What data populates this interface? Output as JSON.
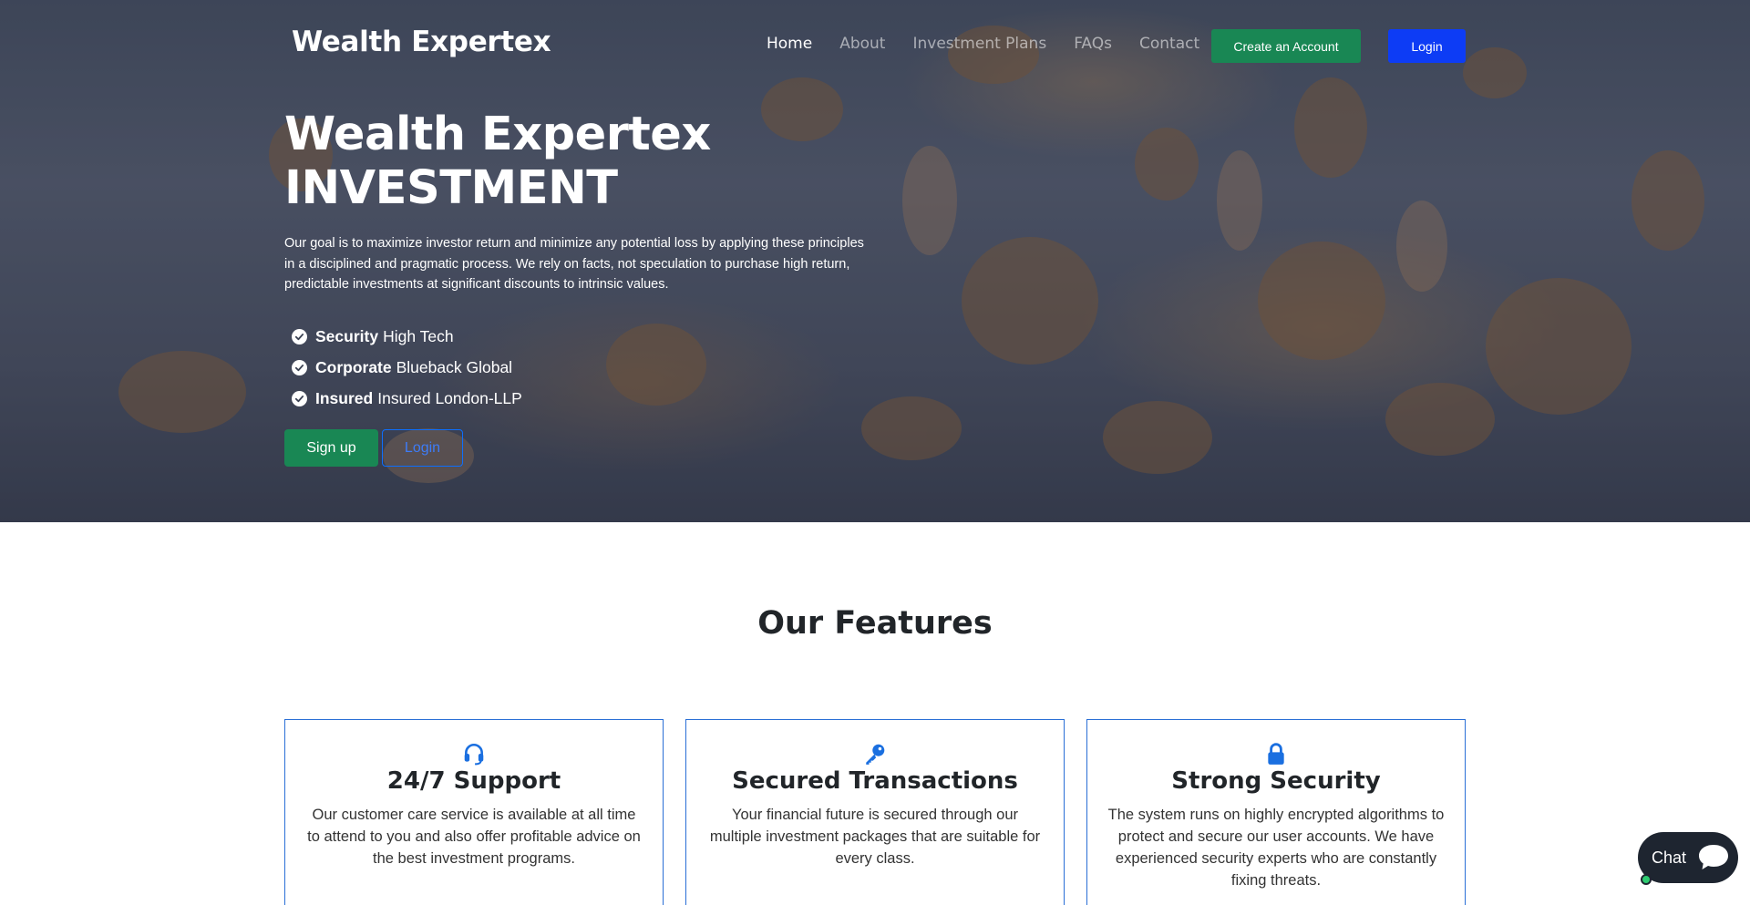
{
  "nav": {
    "brand": "Wealth Expertex",
    "links": [
      {
        "label": "Home",
        "active": true
      },
      {
        "label": "About",
        "active": false
      },
      {
        "label": "Investment Plans",
        "active": false
      },
      {
        "label": "FAQs",
        "active": false
      },
      {
        "label": "Contact",
        "active": false
      }
    ],
    "create_account": "Create an Account",
    "login": "Login"
  },
  "hero": {
    "title_line1": "Wealth Expertex",
    "title_line2": "INVESTMENT",
    "description": "Our goal is to maximize investor return and minimize any potential loss by applying these principles in a disciplined and pragmatic process. We rely on facts, not speculation to purchase high return, predictable investments at significant discounts to intrinsic values.",
    "checks": [
      {
        "strong": "Security",
        "text": "High Tech"
      },
      {
        "strong": "Corporate",
        "text": "Blueback Global"
      },
      {
        "strong": "Insured",
        "text": "Insured London-LLP"
      }
    ],
    "signup": "Sign up",
    "login": "Login"
  },
  "features": {
    "title": "Our Features",
    "cards": [
      {
        "icon": "headset-icon",
        "title": "24/7 Support",
        "text": "Our customer care service is available at all time to attend to you and also offer profitable advice on the best investment programs."
      },
      {
        "icon": "key-icon",
        "title": "Secured Transactions",
        "text": "Your financial future is secured through our multiple investment packages that are suitable for every class."
      },
      {
        "icon": "lock-icon",
        "title": "Strong Security",
        "text": "The system runs on highly encrypted algorithms to protect and secure our user accounts. We have experienced security experts who are constantly fixing threats."
      }
    ]
  },
  "chat": {
    "label": "Chat"
  },
  "colors": {
    "green": "#198754",
    "blue": "#0d3cf5",
    "accent": "#0d6efd"
  }
}
